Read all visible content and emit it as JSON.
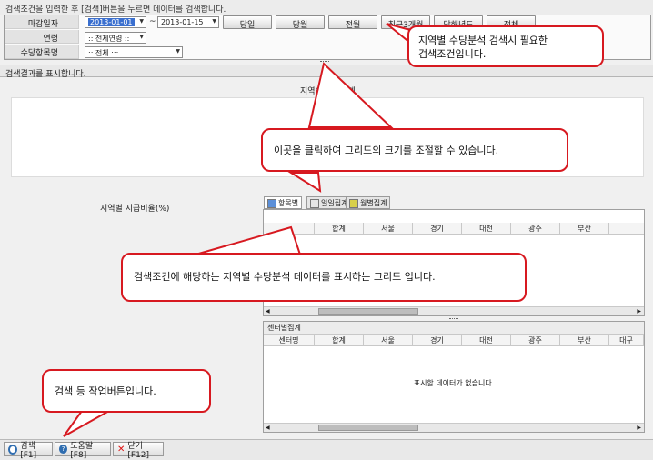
{
  "top_message": "검색조건을 입력한 후 [검색]버튼을 누르면 데이터를 검색합니다.",
  "search": {
    "date_label": "마감일자",
    "date_from": "2013-01-01",
    "date_sep": "~",
    "date_to": "2013-01-15",
    "period_buttons": [
      "당일",
      "당월",
      "전월",
      "최근3개월",
      "당해년도",
      "전체"
    ],
    "group_label": "연령",
    "group_value": ":: 전체연령 ::",
    "item_label": "수당항목명",
    "item_value": ":: 전체 :::"
  },
  "result_header": "검색결과를 표시합니다.",
  "summary_title": "지역별 수당합계",
  "ratio_title": "지역별 지급비율(%)",
  "tabs": [
    "항목별",
    "일일집계",
    "월별집계"
  ],
  "grid_top": {
    "columns": [
      "",
      "합계",
      "서울",
      "경기",
      "대전",
      "광주",
      "부산"
    ]
  },
  "grid_bottom": {
    "title": "센터별집계",
    "columns": [
      "센터명",
      "합계",
      "서울",
      "경기",
      "대전",
      "광주",
      "부산",
      "대구"
    ],
    "empty_message": "표시할 데이터가 없습니다."
  },
  "toolbar": {
    "search_label": "검색[F1]",
    "help_label": "도움말[F8]",
    "close_label": "닫기[F12]"
  },
  "callouts": {
    "search_conditions": "지역별 수당분석 검색시 필요한\n검색조건입니다.",
    "resize": "이곳을 클릭하여 그리드의 크기를 조절할 수 있습니다.",
    "grid": "검색조건에 해당하는 지역별 수당분석 데이터를 표시하는 그리드 입니다.",
    "buttons": "검색 등 작업버튼입니다."
  },
  "colors": {
    "callout_border": "#d71920",
    "selection": "#3a6fcf"
  }
}
